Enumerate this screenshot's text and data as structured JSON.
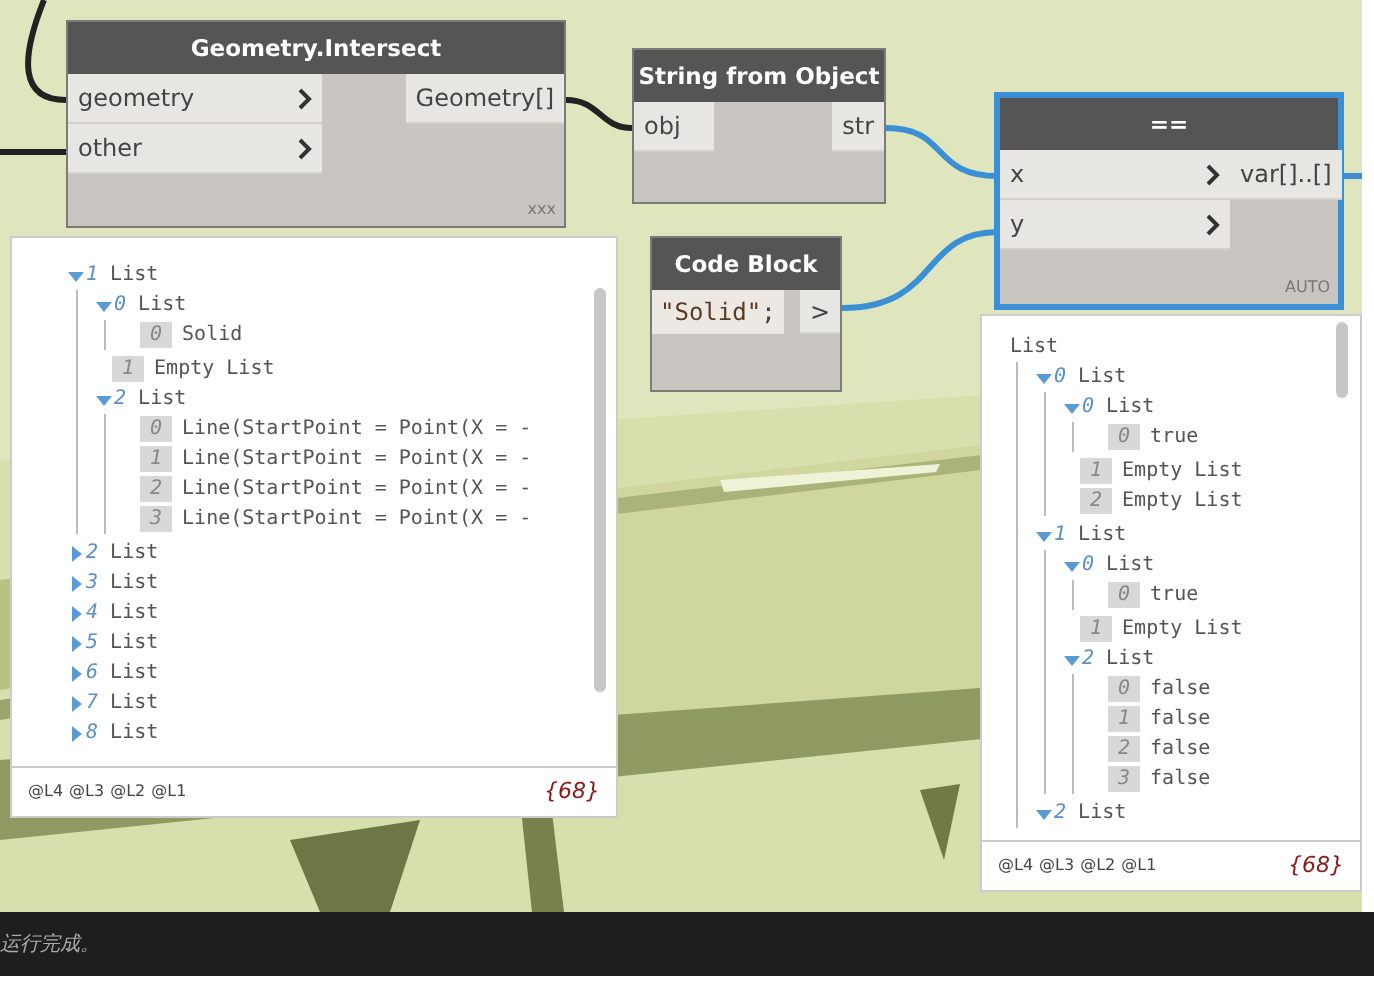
{
  "nodes": [
    {
      "kind": "function",
      "title": "Geometry.Intersect",
      "inputs": [
        "geometry",
        "other"
      ],
      "outputs": [
        "Geometry[]"
      ],
      "port_arrows": true,
      "lacing": "xxx",
      "selected": false
    },
    {
      "kind": "function",
      "title": "String from Object",
      "inputs": [
        "obj"
      ],
      "outputs": [
        "str"
      ],
      "port_arrows": false,
      "selected": false
    },
    {
      "kind": "code",
      "title": "Code Block",
      "code": "\"Solid\";",
      "outputs": [
        ">"
      ],
      "selected": false
    },
    {
      "kind": "function",
      "title": "==",
      "inputs": [
        "x",
        "y"
      ],
      "outputs": [
        "var[]..[]"
      ],
      "port_arrows": true,
      "lacing": "AUTO",
      "selected": true
    }
  ],
  "previews": [
    {
      "items": [
        {
          "kind": "list",
          "index": "1",
          "label": "List",
          "expanded": true,
          "children": [
            {
              "kind": "list",
              "index": "0",
              "label": "List",
              "expanded": true,
              "children": [
                {
                  "kind": "value",
                  "index": "0",
                  "value": "Solid"
                }
              ]
            },
            {
              "kind": "value",
              "index": "1",
              "value": "Empty List"
            },
            {
              "kind": "list",
              "index": "2",
              "label": "List",
              "expanded": true,
              "children": [
                {
                  "kind": "value",
                  "index": "0",
                  "value": "Line(StartPoint = Point(X = -"
                },
                {
                  "kind": "value",
                  "index": "1",
                  "value": "Line(StartPoint = Point(X = -"
                },
                {
                  "kind": "value",
                  "index": "2",
                  "value": "Line(StartPoint = Point(X = -"
                },
                {
                  "kind": "value",
                  "index": "3",
                  "value": "Line(StartPoint = Point(X = -"
                }
              ]
            }
          ]
        },
        {
          "kind": "list",
          "index": "2",
          "label": "List",
          "expanded": false
        },
        {
          "kind": "list",
          "index": "3",
          "label": "List",
          "expanded": false
        },
        {
          "kind": "list",
          "index": "4",
          "label": "List",
          "expanded": false
        },
        {
          "kind": "list",
          "index": "5",
          "label": "List",
          "expanded": false
        },
        {
          "kind": "list",
          "index": "6",
          "label": "List",
          "expanded": false
        },
        {
          "kind": "list",
          "index": "7",
          "label": "List",
          "expanded": false
        },
        {
          "kind": "list",
          "index": "8",
          "label": "List",
          "expanded": false
        }
      ],
      "levels": [
        "@L4",
        "@L3",
        "@L2",
        "@L1"
      ],
      "count": "{68}"
    },
    {
      "items": [
        {
          "kind": "list",
          "label": "List",
          "children": [
            {
              "kind": "list",
              "index": "0",
              "label": "List",
              "expanded": true,
              "children": [
                {
                  "kind": "list",
                  "index": "0",
                  "label": "List",
                  "expanded": true,
                  "children": [
                    {
                      "kind": "value",
                      "index": "0",
                      "value": "true"
                    }
                  ]
                },
                {
                  "kind": "value",
                  "index": "1",
                  "value": "Empty List"
                },
                {
                  "kind": "value",
                  "index": "2",
                  "value": "Empty List"
                }
              ]
            },
            {
              "kind": "list",
              "index": "1",
              "label": "List",
              "expanded": true,
              "children": [
                {
                  "kind": "list",
                  "index": "0",
                  "label": "List",
                  "expanded": true,
                  "children": [
                    {
                      "kind": "value",
                      "index": "0",
                      "value": "true"
                    }
                  ]
                },
                {
                  "kind": "value",
                  "index": "1",
                  "value": "Empty List"
                },
                {
                  "kind": "list",
                  "index": "2",
                  "label": "List",
                  "expanded": true,
                  "children": [
                    {
                      "kind": "value",
                      "index": "0",
                      "value": "false"
                    },
                    {
                      "kind": "value",
                      "index": "1",
                      "value": "false"
                    },
                    {
                      "kind": "value",
                      "index": "2",
                      "value": "false"
                    },
                    {
                      "kind": "value",
                      "index": "3",
                      "value": "false"
                    }
                  ]
                }
              ]
            },
            {
              "kind": "list",
              "index": "2",
              "label": "List",
              "expanded": true
            }
          ]
        }
      ],
      "levels": [
        "@L4",
        "@L3",
        "@L2",
        "@L1"
      ],
      "count": "{68}"
    }
  ],
  "status_bar": "运行完成。"
}
